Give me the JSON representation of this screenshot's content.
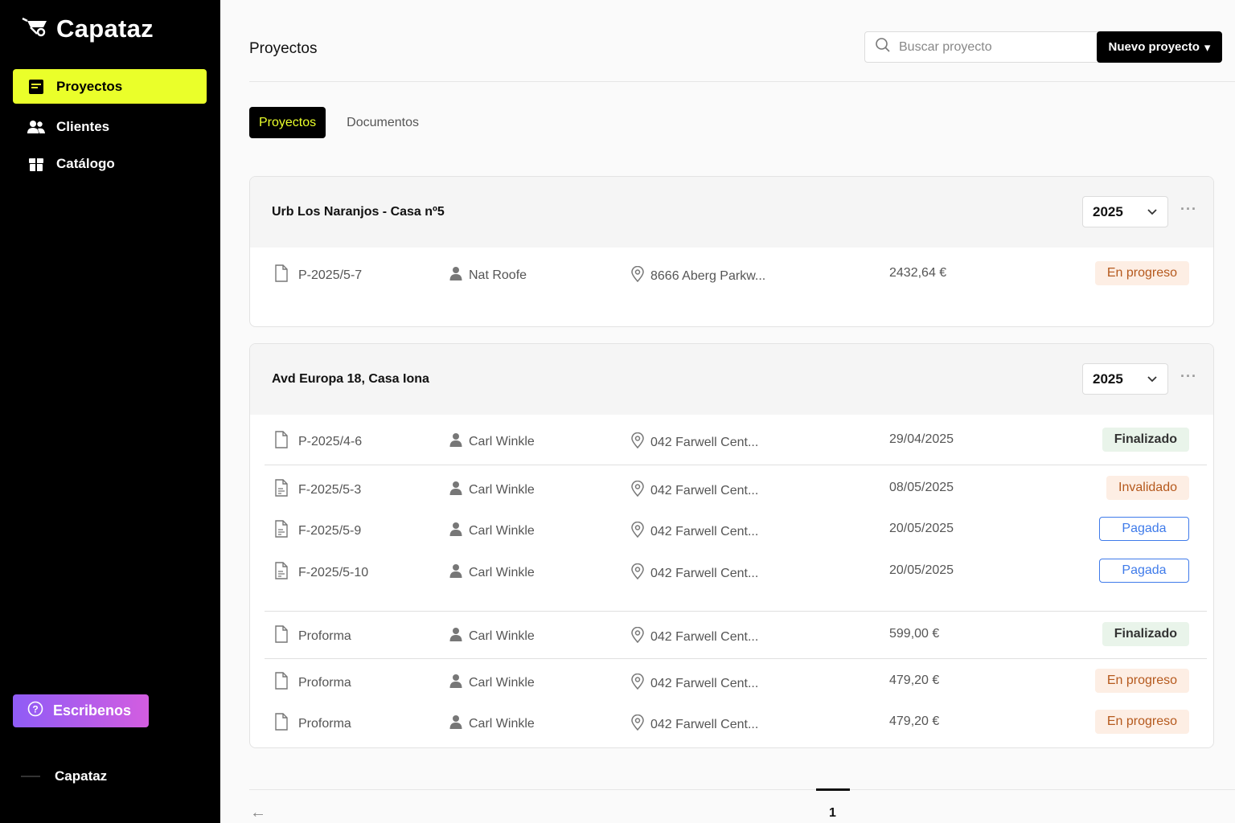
{
  "app": {
    "name": "Capataz"
  },
  "sidebar": {
    "items": [
      {
        "label": "Proyectos",
        "icon": "projects-icon",
        "active": true
      },
      {
        "label": "Clientes",
        "icon": "users-icon",
        "active": false
      },
      {
        "label": "Catálogo",
        "icon": "catalog-icon",
        "active": false
      }
    ],
    "help_button": "Escribenos",
    "account_name": "Capataz"
  },
  "header": {
    "title": "Proyectos",
    "search_placeholder": "Buscar proyecto",
    "new_button": "Nuevo proyecto"
  },
  "tabs": [
    {
      "label": "Proyectos",
      "active": true
    },
    {
      "label": "Documentos",
      "active": false
    }
  ],
  "groups": [
    {
      "title": "Urb Los Naranjos - Casa nº5",
      "year": "2025",
      "rows": [
        {
          "doc": "P-2025/5-7",
          "client": "Nat Roofe",
          "address": "8666 Aberg Parkw...",
          "value": "2432,64 €",
          "status": "En progreso",
          "status_type": "progress"
        }
      ]
    },
    {
      "title": "Avd Europa 18, Casa Iona",
      "year": "2025",
      "rows": [
        {
          "doc": "P-2025/4-6",
          "client": "Carl Winkle",
          "address": "042 Farwell Cent...",
          "value": "29/04/2025",
          "status": "Finalizado",
          "status_type": "done"
        },
        {
          "doc": "F-2025/5-3",
          "client": "Carl Winkle",
          "address": "042 Farwell Cent...",
          "value": "08/05/2025",
          "status": "Invalidado",
          "status_type": "invalid"
        },
        {
          "doc": "F-2025/5-9",
          "client": "Carl Winkle",
          "address": "042 Farwell Cent...",
          "value": "20/05/2025",
          "status": "Pagada",
          "status_type": "paid"
        },
        {
          "doc": "F-2025/5-10",
          "client": "Carl Winkle",
          "address": "042 Farwell Cent...",
          "value": "20/05/2025",
          "status": "Pagada",
          "status_type": "paid"
        },
        {
          "doc": "Proforma",
          "client": "Carl Winkle",
          "address": "042 Farwell Cent...",
          "value": "599,00 €",
          "status": "Finalizado",
          "status_type": "done"
        },
        {
          "doc": "Proforma",
          "client": "Carl Winkle",
          "address": "042 Farwell Cent...",
          "value": "479,20 €",
          "status": "En progreso",
          "status_type": "progress"
        },
        {
          "doc": "Proforma",
          "client": "Carl Winkle",
          "address": "042 Farwell Cent...",
          "value": "479,20 €",
          "status": "En progreso",
          "status_type": "progress"
        }
      ]
    }
  ],
  "pagination": {
    "current_page": "1"
  },
  "colors": {
    "accent": "#eaff2a",
    "sidebar_bg": "#000000",
    "paid_blue": "#3f7bea",
    "progress_orange": "#b5591d"
  }
}
